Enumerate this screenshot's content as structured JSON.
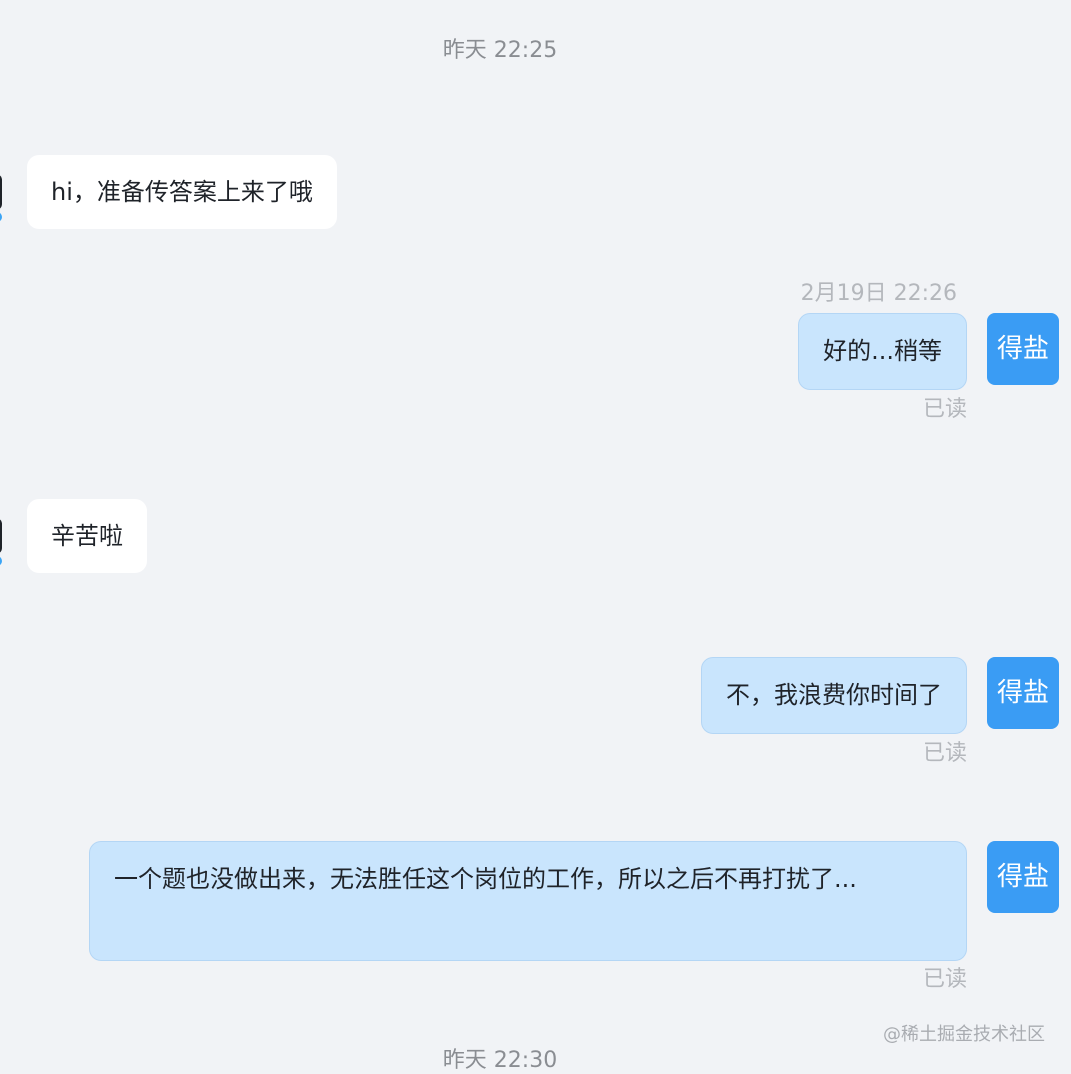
{
  "timestamps": {
    "top": "昨天 22:25",
    "bottom": "昨天 22:30",
    "msg2": "2月19日 22:26"
  },
  "messages": [
    {
      "text": "hi，准备传答案上来了哦"
    },
    {
      "text": "好的...稍等",
      "status": "已读",
      "avatar": "得盐"
    },
    {
      "text": "辛苦啦"
    },
    {
      "text": "不，我浪费你时间了",
      "status": "已读",
      "avatar": "得盐"
    },
    {
      "text": "一个题也没做出来，无法胜任这个岗位的工作，所以之后不再打扰了...",
      "status": "已读",
      "avatar": "得盐"
    }
  ],
  "watermark": "@稀土掘金技术社区",
  "colors": {
    "background": "#f1f3f6",
    "incoming_bubble": "#ffffff",
    "outgoing_bubble": "#c9e5fd",
    "avatar": "#3a9cf4",
    "read_status": "#b4b7bc"
  }
}
